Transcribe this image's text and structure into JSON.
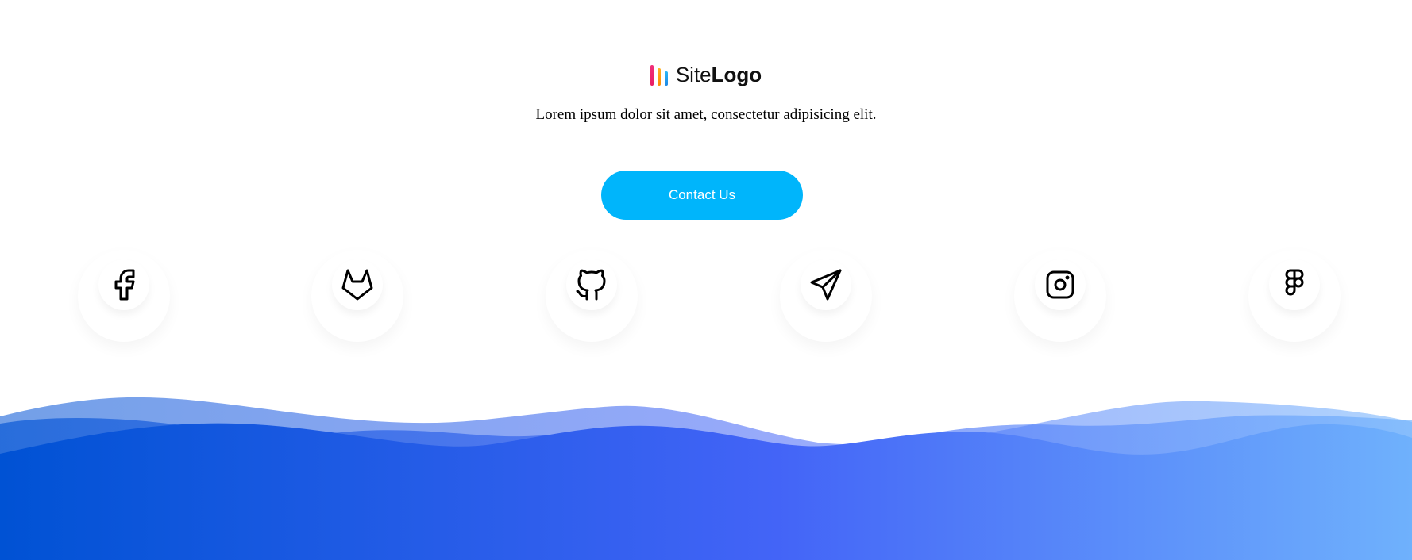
{
  "logo": {
    "text_light": "Site",
    "text_bold": "Logo",
    "bar_colors": [
      "#ee2a7b",
      "#ff9f1c",
      "#1fa2ff"
    ]
  },
  "tagline": "Lorem ipsum dolor sit amet, consectetur adipisicing elit.",
  "contact_button": {
    "label": "Contact Us",
    "color": "#00b5fb"
  },
  "social": [
    {
      "icon": "facebook-icon"
    },
    {
      "icon": "gitlab-icon"
    },
    {
      "icon": "github-icon"
    },
    {
      "icon": "telegram-icon"
    },
    {
      "icon": "instagram-icon"
    },
    {
      "icon": "figma-icon"
    }
  ],
  "wave_gradient": [
    "#0052d4",
    "#4364f7",
    "#6fb1fc"
  ]
}
